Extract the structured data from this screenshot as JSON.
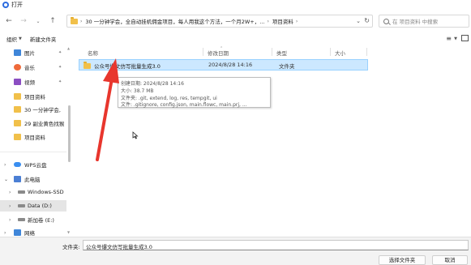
{
  "window": {
    "title": "打开"
  },
  "nav": {
    "breadcrumb": [
      "30 一分钟学会，全自动挂机佣金项目，每人用我这个方法，一个月2W+，...",
      "项目资料"
    ],
    "search_placeholder": "在 项目资料 中搜索"
  },
  "toolbar": {
    "organize_label": "组织",
    "new_folder_label": "新建文件夹"
  },
  "sidebar": {
    "items": [
      {
        "label": "图片",
        "icon": "pictures-icon",
        "pinned": true
      },
      {
        "label": "音乐",
        "icon": "music-icon",
        "pinned": true
      },
      {
        "label": "视频",
        "icon": "video-icon",
        "pinned": true
      },
      {
        "label": "项目资料",
        "icon": "folder-icon",
        "pinned": false
      },
      {
        "label": "30 一分钟学会,",
        "icon": "folder-icon",
        "pinned": false
      },
      {
        "label": "29 副业黄色找猴",
        "icon": "folder-icon",
        "pinned": false
      },
      {
        "label": "项目资料",
        "icon": "folder-icon",
        "pinned": false
      },
      {
        "label": "WPS云盘",
        "icon": "cloud-icon",
        "pinned": false
      },
      {
        "label": "此电脑",
        "icon": "pc-icon",
        "pinned": false
      },
      {
        "label": "Windows-SSD",
        "icon": "drive-icon",
        "pinned": false
      },
      {
        "label": "Data (D:)",
        "icon": "drive-icon",
        "pinned": false
      },
      {
        "label": "新加卷 (E:)",
        "icon": "drive-icon",
        "pinned": false
      },
      {
        "label": "网络",
        "icon": "network-icon",
        "pinned": false
      }
    ]
  },
  "file_list": {
    "columns": [
      "名称",
      "修改日期",
      "类型",
      "大小"
    ],
    "rows": [
      {
        "name": "公众号爆文仿写批量生成3.0",
        "modified": "2024/8/28 14:16",
        "type": "文件夹",
        "size": ""
      }
    ]
  },
  "tooltip": {
    "created": "创建日期: 2024/8/28 14:16",
    "size": "大小: 38.7 MB",
    "folders": "文件夹: .git, extend, log, res, tempgit, ui",
    "files": "文件: .gitignore, config.json, main.flowc, main.prj, ..."
  },
  "footer": {
    "filename_label": "文件夹:",
    "filename_value": "公众号爆文仿写批量生成3.0",
    "select_button": "选择文件夹",
    "cancel_button": "取消"
  },
  "colors": {
    "selection_bg": "#cce8ff",
    "selection_border": "#99d1ff",
    "annotation_arrow": "#e8362d",
    "folder": "#f1c04a"
  }
}
